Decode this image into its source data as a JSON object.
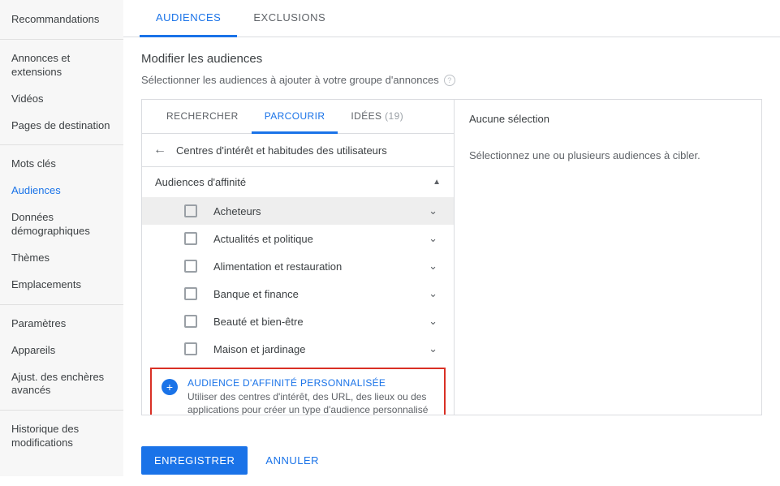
{
  "sidebar": {
    "groups": [
      [
        "Recommandations"
      ],
      [
        "Annonces et extensions",
        "Vidéos",
        "Pages de destination"
      ],
      [
        "Mots clés",
        "Audiences",
        "Données démographiques",
        "Thèmes",
        "Emplacements"
      ],
      [
        "Paramètres",
        "Appareils",
        "Ajust. des enchères avancés"
      ],
      [
        "Historique des modifications"
      ]
    ],
    "active": "Audiences"
  },
  "topTabs": {
    "audiences": "AUDIENCES",
    "exclusions": "EXCLUSIONS"
  },
  "header": {
    "title": "Modifier les audiences",
    "subtitle": "Sélectionner les audiences à ajouter à votre groupe d'annonces",
    "helpGlyph": "?"
  },
  "innerTabs": {
    "search": "RECHERCHER",
    "browse": "PARCOURIR",
    "ideas": "IDÉES",
    "ideasCount": "(19)"
  },
  "breadcrumb": {
    "backGlyph": "←",
    "text": "Centres d'intérêt et habitudes des utilisateurs"
  },
  "group": {
    "title": "Audiences d'affinité",
    "items": [
      "Acheteurs",
      "Actualités et politique",
      "Alimentation et restauration",
      "Banque et finance",
      "Beauté et bien-être",
      "Maison et jardinage"
    ]
  },
  "customAffinity": {
    "title": "AUDIENCE D'AFFINITÉ PERSONNALISÉE",
    "desc": "Utiliser des centres d'intérêt, des URL, des lieux ou des applications pour créer un type d'audience personnalisé",
    "plusGlyph": "+"
  },
  "selection": {
    "title": "Aucune sélection",
    "desc": "Sélectionnez une ou plusieurs audiences à cibler."
  },
  "actions": {
    "save": "ENREGISTRER",
    "cancel": "ANNULER"
  },
  "glyphs": {
    "chevUp": "▲",
    "chevDown": "⌄"
  }
}
